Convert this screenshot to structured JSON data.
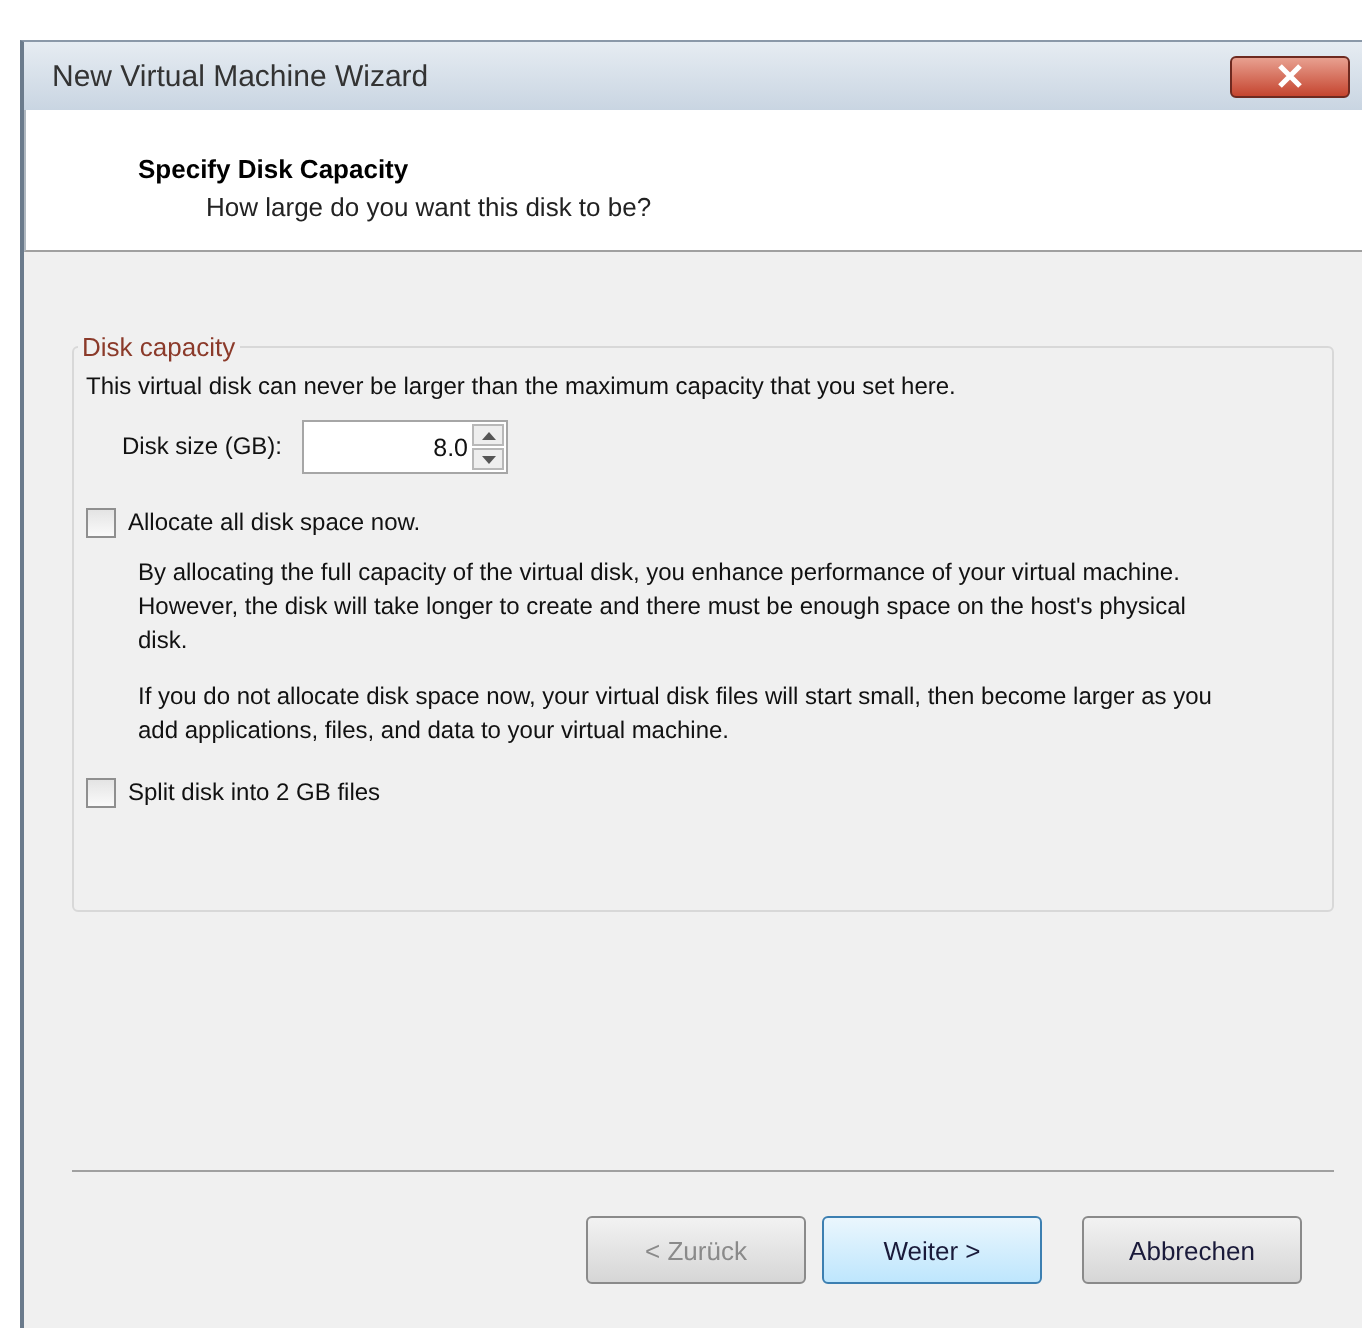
{
  "window": {
    "title": "New Virtual Machine Wizard"
  },
  "header": {
    "title": "Specify Disk Capacity",
    "subtitle": "How large do you want this disk to be?"
  },
  "group": {
    "legend": "Disk capacity",
    "intro": "This virtual disk can never be larger than the maximum capacity that you set here.",
    "size_label": "Disk size (GB):",
    "size_value": "8.0"
  },
  "options": [
    {
      "label": "Allocate all disk space now.",
      "checked": false,
      "notes": [
        "By allocating the full capacity of the virtual disk, you enhance performance of your virtual machine.  However, the disk will take longer to create and there must be enough space on the host's physical disk.",
        "If you do not allocate disk space now, your virtual disk files will start small, then become larger as you add applications, files, and data to your virtual machine."
      ]
    },
    {
      "label": "Split disk into 2 GB files",
      "checked": false
    }
  ],
  "buttons": [
    {
      "label": "< Zurück",
      "kind": "disabled"
    },
    {
      "label": "Weiter >",
      "kind": "default"
    },
    {
      "label": "Abbrechen",
      "kind": "normal"
    }
  ]
}
